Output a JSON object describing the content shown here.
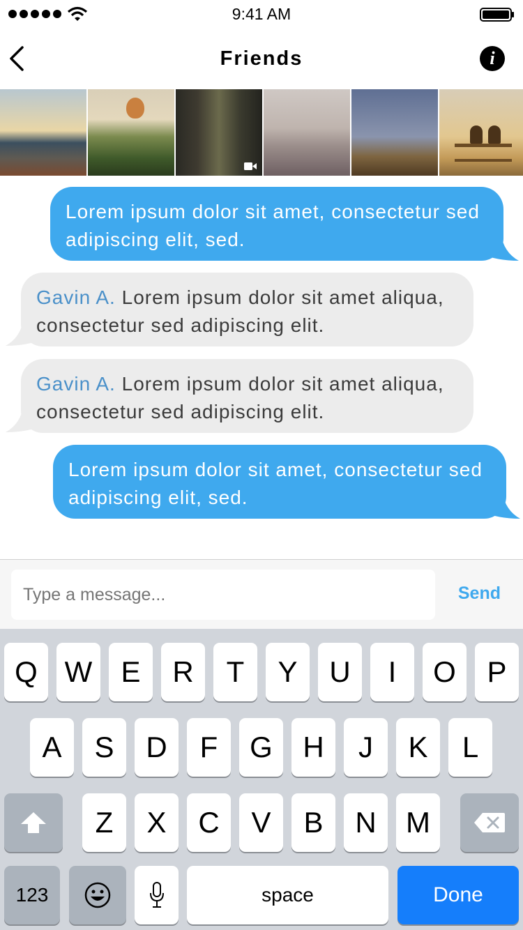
{
  "status_bar": {
    "time": "9:41 AM"
  },
  "nav": {
    "title": "Friends"
  },
  "photos": [
    {
      "name": "photo-harbor-sunset"
    },
    {
      "name": "photo-hot-air-balloon"
    },
    {
      "name": "photo-forest-path",
      "badge": "video-icon"
    },
    {
      "name": "photo-beach"
    },
    {
      "name": "photo-desert-dunes"
    },
    {
      "name": "photo-couple-on-bench"
    }
  ],
  "messages": [
    {
      "direction": "outgoing",
      "text": "Lorem ipsum dolor sit amet, consectetur sed adipiscing elit, sed."
    },
    {
      "direction": "incoming",
      "sender": "Gavin A.",
      "text": "Lorem ipsum dolor sit amet aliqua, consectetur sed adipiscing elit."
    },
    {
      "direction": "incoming",
      "sender": "Gavin A.",
      "text": "Lorem ipsum dolor sit amet aliqua, consectetur sed adipiscing elit."
    },
    {
      "direction": "outgoing",
      "text": "Lorem ipsum dolor sit amet, consectetur sed adipiscing elit, sed."
    }
  ],
  "composer": {
    "placeholder": "Type a message...",
    "send_label": "Send"
  },
  "keyboard": {
    "row1": [
      "Q",
      "W",
      "E",
      "R",
      "T",
      "Y",
      "U",
      "I",
      "O",
      "P"
    ],
    "row2": [
      "A",
      "S",
      "D",
      "F",
      "G",
      "H",
      "J",
      "K",
      "L"
    ],
    "row3": [
      "Z",
      "X",
      "C",
      "V",
      "B",
      "N",
      "M"
    ],
    "numbers_label": "123",
    "space_label": "space",
    "done_label": "Done"
  },
  "colors": {
    "outgoing_bubble": "#3fa9ee",
    "incoming_bubble": "#ececec",
    "sender_name": "#4a90c9",
    "send_button": "#3fa9ee",
    "done_key": "#157efb"
  }
}
